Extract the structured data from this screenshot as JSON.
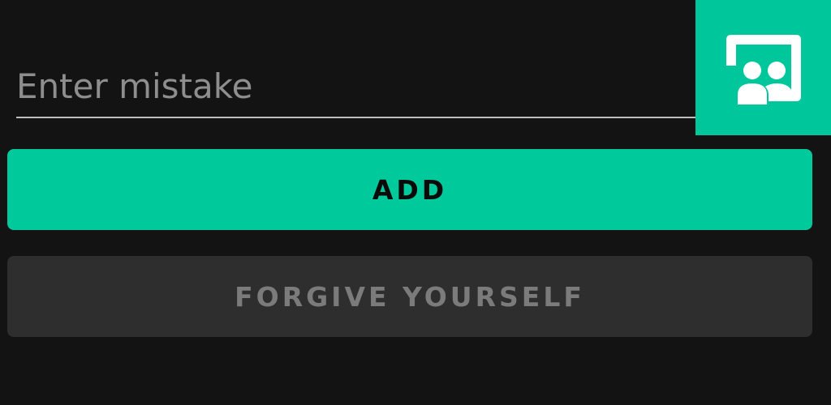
{
  "mistake_input": {
    "value": "",
    "placeholder": "Enter mistake"
  },
  "buttons": {
    "add_label": "ADD",
    "forgive_label": "FORGIVE YOURSELF"
  },
  "badge": {
    "icon": "group-board-icon"
  },
  "colors": {
    "background": "#131313",
    "accent": "#00c99c",
    "disabled_button": "#2e2e2e",
    "disabled_text": "#7b7b7b"
  }
}
